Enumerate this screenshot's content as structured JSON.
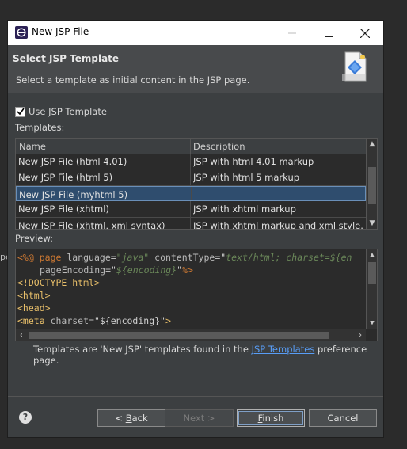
{
  "window": {
    "title": "New JSP File"
  },
  "header": {
    "title": "Select JSP Template",
    "subtitle": "Select a template as initial content in the JSP page."
  },
  "use_template": {
    "label_prefix": "U",
    "label_rest": "se JSP Template",
    "checked": true
  },
  "templates": {
    "label": "Templates:",
    "columns": [
      "Name",
      "Description"
    ],
    "rows": [
      {
        "name": "New JSP File (html 4.01)",
        "description": "JSP with html 4.01 markup"
      },
      {
        "name": "New JSP File (html 5)",
        "description": "JSP with html 5 markup"
      },
      {
        "name": "New JSP File (myhtml 5)",
        "description": ""
      },
      {
        "name": "New JSP File (xhtml)",
        "description": "JSP with xhtml markup"
      },
      {
        "name": "New JSP File (xhtml, xml syntax)",
        "description": "JSP with xhtml markup and xml style..."
      }
    ],
    "selected_index": 2
  },
  "preview": {
    "label": "Preview:",
    "line1": {
      "open": "<%@",
      "directive": "page",
      "a1": "language=",
      "v1": "\"java\"",
      "a2": "contentType=",
      "q": "\"",
      "v2": "text/html; charset=${en"
    },
    "line2": {
      "attr": "pageEncoding=",
      "q1": "\"",
      "val": "${encoding}",
      "q2": "\"",
      "close": "%>"
    },
    "line3": {
      "open": "<!DOCTYPE",
      "name": "html",
      "close": ">"
    },
    "line4": "<html>",
    "line5": "<head>",
    "line6": {
      "open": "<meta",
      "attr": "charset=",
      "val": "\"${encoding}\"",
      "close": ">"
    }
  },
  "info": {
    "before": "Templates are 'New JSP' templates found in the ",
    "link": "JSP Templates",
    "after": " preference page."
  },
  "buttons": {
    "back_prefix": "< ",
    "back_u": "B",
    "back_rest": "ack",
    "next": "Next >",
    "finish_u": "F",
    "finish_rest": "inish",
    "cancel": "Cancel"
  },
  "background": {
    "left_fragment": "pe"
  }
}
